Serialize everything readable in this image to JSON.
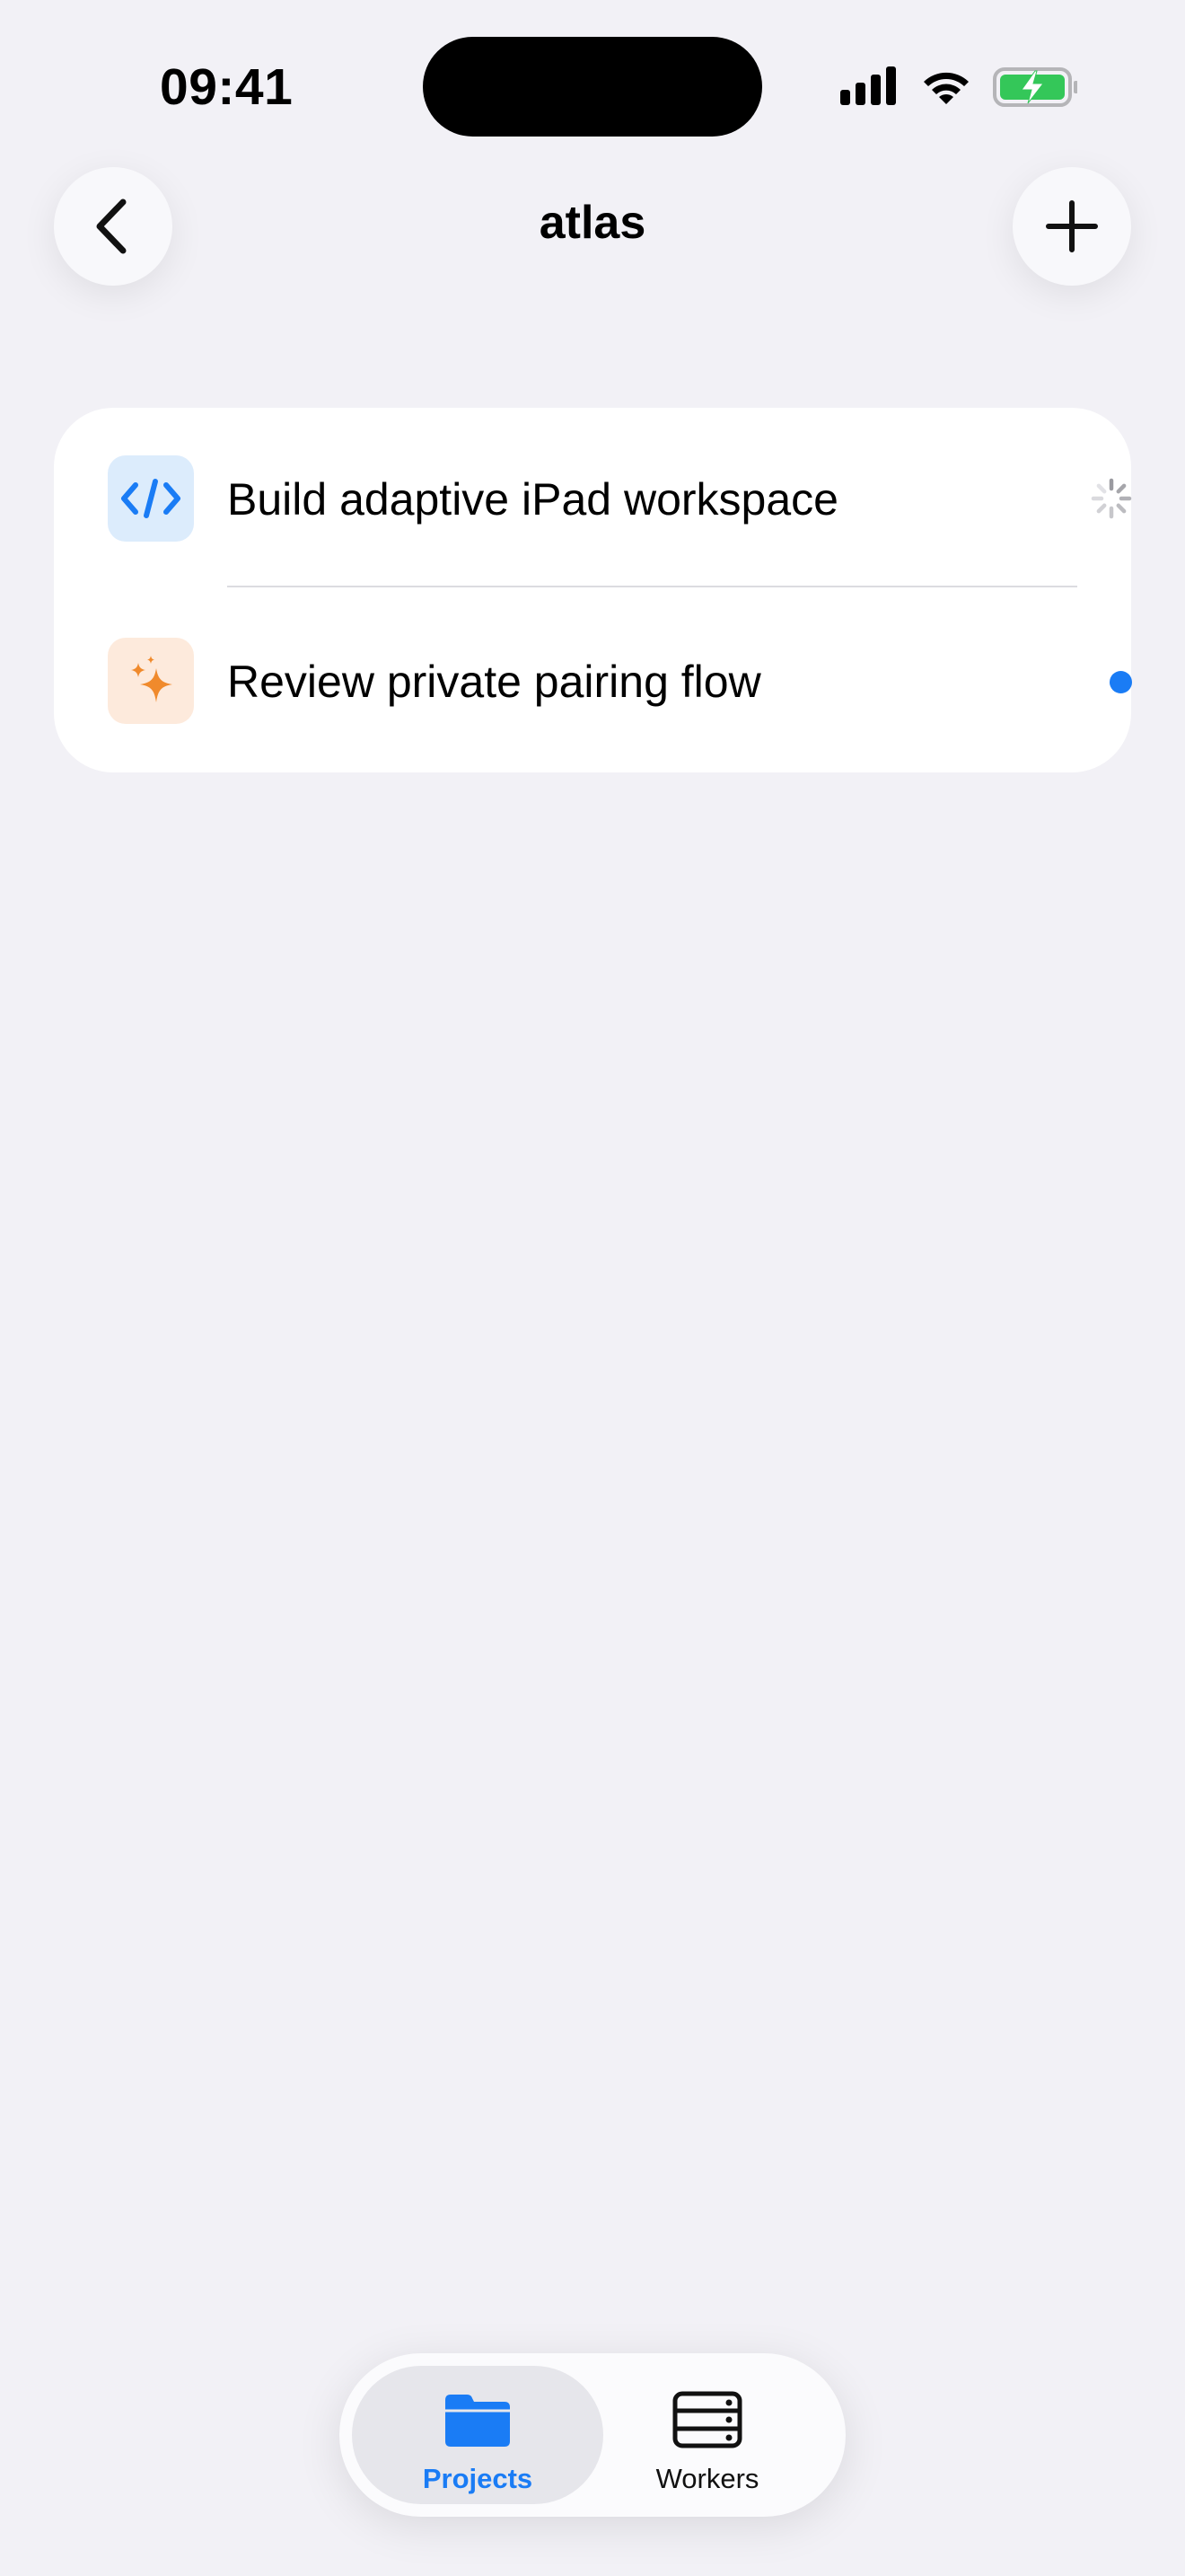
{
  "status_bar": {
    "time": "09:41"
  },
  "nav": {
    "title": "atlas",
    "back_icon": "chevron-left-icon",
    "add_icon": "plus-icon"
  },
  "threads": [
    {
      "label": "Build adaptive iPad workspace",
      "icon": "code-icon",
      "icon_color": "#1a7cf5",
      "status": "loading"
    },
    {
      "label": "Review private pairing flow",
      "icon": "sparkles-icon",
      "icon_color": "#f08a2c",
      "status": "unread"
    }
  ],
  "tabbar": {
    "tabs": [
      {
        "label": "Projects",
        "icon": "folder-icon",
        "selected": true
      },
      {
        "label": "Workers",
        "icon": "server-rack-icon",
        "selected": false
      }
    ]
  },
  "colors": {
    "accent": "#1a7cf5",
    "background": "#f2f1f6",
    "battery_green": "#34c759"
  }
}
